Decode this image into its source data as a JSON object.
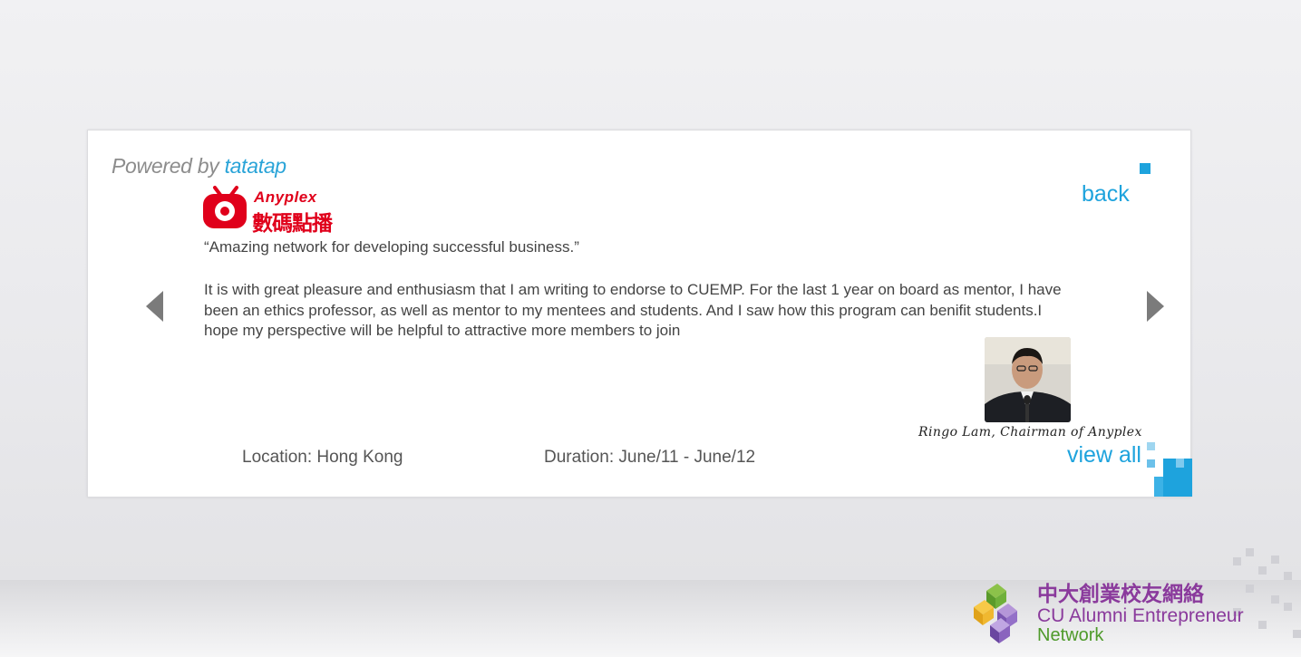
{
  "powered": {
    "prefix": "Powered by",
    "brand": "tatatap"
  },
  "logo": {
    "name": "Anyplex",
    "cjk": "數碼點播",
    "icon": "anyplex-tv-icon"
  },
  "testimonial": {
    "headline": "“Amazing network for developing successful business.”",
    "body": "It is with great pleasure and enthusiasm that I am writing to endorse  to CUEMP. For the last 1 year on board as mentor, I have been an ethics professor, as well as mentor to my mentees and students. And I saw how this program can benifit students.I hope my perspective will be helpful to attractive more members to join",
    "author": "Ringo  Lam,  Chairman  of  Anyplex"
  },
  "details": {
    "location": "Location: Hong Kong",
    "duration": "Duration: June/11 - June/12"
  },
  "nav": {
    "back": "back",
    "view_all": "view all",
    "prev_icon": "chevron-left-icon",
    "next_icon": "chevron-right-icon"
  },
  "footer_logo": {
    "cjk": "中大創業校友網絡",
    "line1": "CU Alumni Entrepreneur",
    "line2": "Network"
  },
  "colors": {
    "accent": "#1ea3dd",
    "brand_red": "#e0001b",
    "cu_purple": "#8a3a9c",
    "cu_green": "#4e9a2a"
  }
}
